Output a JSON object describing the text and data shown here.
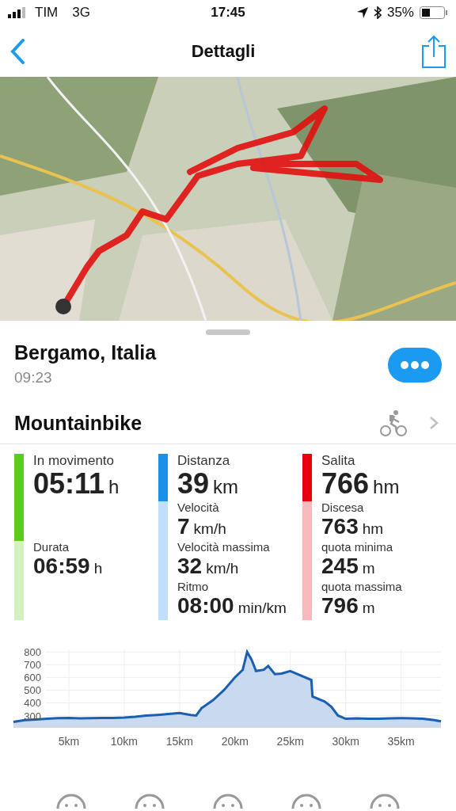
{
  "status_bar": {
    "carrier": "TIM",
    "network": "3G",
    "time": "17:45",
    "battery": "35%"
  },
  "nav": {
    "title": "Dettagli"
  },
  "activity": {
    "place": "Bergamo, Italia",
    "time": "09:23",
    "sport": "Mountainbike"
  },
  "stats": [
    {
      "color": "#5ccb1b",
      "label": "In movimento",
      "value": "05:11",
      "unit": "h",
      "details": [
        {
          "label": "Durata",
          "value": "06:59",
          "unit": "h"
        }
      ]
    },
    {
      "color": "#1b90e8",
      "label": "Distanza",
      "value": "39",
      "unit": "km",
      "details": [
        {
          "label": "Velocità",
          "value": "7",
          "unit": "km/h"
        },
        {
          "label": "Velocità massima",
          "value": "32",
          "unit": "km/h"
        },
        {
          "label": "Ritmo",
          "value": "08:00",
          "unit": "min/km"
        }
      ]
    },
    {
      "color": "#e8000f",
      "label": "Salita",
      "value": "766",
      "unit": "hm",
      "details": [
        {
          "label": "Discesa",
          "value": "763",
          "unit": "hm"
        },
        {
          "label": "quota minima",
          "value": "245",
          "unit": "m"
        },
        {
          "label": "quota massima",
          "value": "796",
          "unit": "m"
        }
      ]
    }
  ],
  "chart_data": {
    "type": "area",
    "x": [
      0,
      1,
      2,
      3,
      4,
      5,
      6,
      7,
      8,
      9,
      10,
      11,
      12,
      13,
      14,
      15,
      16,
      16.5,
      17,
      18,
      19,
      20,
      20.7,
      21.1,
      21.5,
      21.9,
      22.6,
      23.0,
      23.6,
      24.2,
      25.0,
      26.9,
      27.0,
      28.1,
      28.7,
      29.3,
      30,
      31,
      32,
      33,
      34,
      35,
      36,
      37,
      38,
      38.6
    ],
    "series": [
      {
        "color": "#1a5fb0",
        "values": [
          250,
          265,
          270,
          275,
          280,
          282,
          278,
          280,
          282,
          282,
          285,
          290,
          300,
          305,
          312,
          320,
          305,
          300,
          360,
          420,
          500,
          600,
          660,
          800,
          740,
          650,
          660,
          690,
          625,
          630,
          650,
          580,
          450,
          410,
          370,
          300,
          275,
          278,
          276,
          276,
          278,
          280,
          278,
          275,
          265,
          255
        ]
      }
    ],
    "xlim": [
      0,
      38.6
    ],
    "ylim": [
      210,
      820
    ],
    "xticks": [
      {
        "value": 5,
        "label": "5km"
      },
      {
        "value": 10,
        "label": "10km"
      },
      {
        "value": 15,
        "label": "15km"
      },
      {
        "value": 20,
        "label": "20km"
      },
      {
        "value": 25,
        "label": "25km"
      },
      {
        "value": 30,
        "label": "30km"
      },
      {
        "value": 35,
        "label": "35km"
      }
    ],
    "yticks": [
      300,
      400,
      500,
      600,
      700,
      800
    ],
    "grid": true
  }
}
